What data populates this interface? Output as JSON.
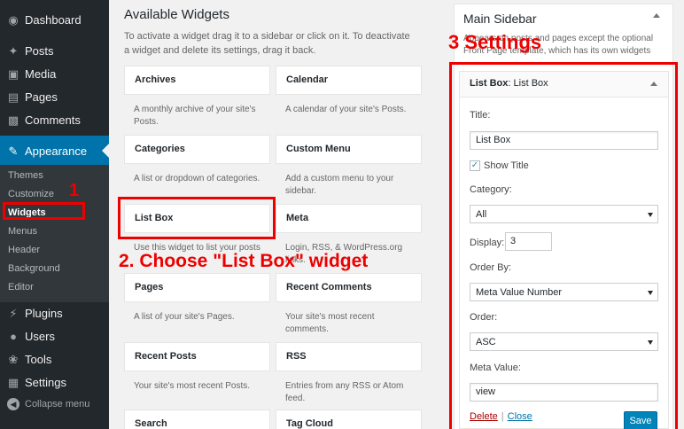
{
  "admin_menu": {
    "top_items": [
      {
        "label": "Dashboard",
        "icon": "dashboard-icon"
      },
      {
        "label": "Posts",
        "icon": "pin-icon"
      },
      {
        "label": "Media",
        "icon": "media-icon"
      },
      {
        "label": "Pages",
        "icon": "pages-icon"
      },
      {
        "label": "Comments",
        "icon": "comments-icon"
      }
    ],
    "appearance": {
      "label": "Appearance",
      "icon": "paintbrush-icon"
    },
    "submenu": [
      "Themes",
      "Customize",
      "Widgets",
      "Menus",
      "Header",
      "Background",
      "Editor"
    ],
    "bottom_items": [
      {
        "label": "Plugins",
        "icon": "plugin-icon"
      },
      {
        "label": "Users",
        "icon": "users-icon"
      },
      {
        "label": "Tools",
        "icon": "wrench-icon"
      },
      {
        "label": "Settings",
        "icon": "settings-icon"
      }
    ],
    "collapse_label": "Collapse menu"
  },
  "available": {
    "title": "Available Widgets",
    "description": "To activate a widget drag it to a sidebar or click on it. To deactivate a widget and delete its settings, drag it back.",
    "widgets": [
      {
        "name": "Archives",
        "desc": "A monthly archive of your site's Posts."
      },
      {
        "name": "Calendar",
        "desc": "A calendar of your site's Posts."
      },
      {
        "name": "Categories",
        "desc": "A list or dropdown of categories."
      },
      {
        "name": "Custom Menu",
        "desc": "Add a custom menu to your sidebar."
      },
      {
        "name": "List Box",
        "desc": "Use this widget to list your posts"
      },
      {
        "name": "Meta",
        "desc": "Login, RSS, & WordPress.org links."
      },
      {
        "name": "Pages",
        "desc": "A list of your site's Pages."
      },
      {
        "name": "Recent Comments",
        "desc": "Your site's most recent comments."
      },
      {
        "name": "Recent Posts",
        "desc": "Your site's most recent Posts."
      },
      {
        "name": "RSS",
        "desc": "Entries from any RSS or Atom feed."
      },
      {
        "name": "Search",
        "desc": ""
      },
      {
        "name": "Tag Cloud",
        "desc": ""
      }
    ]
  },
  "sidebar": {
    "title": "Main Sidebar",
    "description": "Appears on posts and pages except the optional Front Page template, which has its own widgets"
  },
  "listbox_widget": {
    "title": "List Box",
    "subtitle": ": List Box",
    "title_label": "Title:",
    "title_value": "List Box",
    "show_title_label": "Show Title",
    "show_title_checked": true,
    "category_label": "Category:",
    "category_value": "All",
    "display_label": "Display:",
    "display_value": "3",
    "order_by_label": "Order By:",
    "order_by_value": "Meta Value Number",
    "order_label": "Order:",
    "order_value": "ASC",
    "meta_value_label": "Meta Value:",
    "meta_value_value": "view",
    "delete_label": "Delete",
    "separator": "|",
    "close_label": "Close",
    "save_label": "Save"
  },
  "annotations": {
    "step1": "1",
    "step2": "2. Choose \"List Box\" widget",
    "step3": "3 Settings",
    "color": "#e00000"
  }
}
